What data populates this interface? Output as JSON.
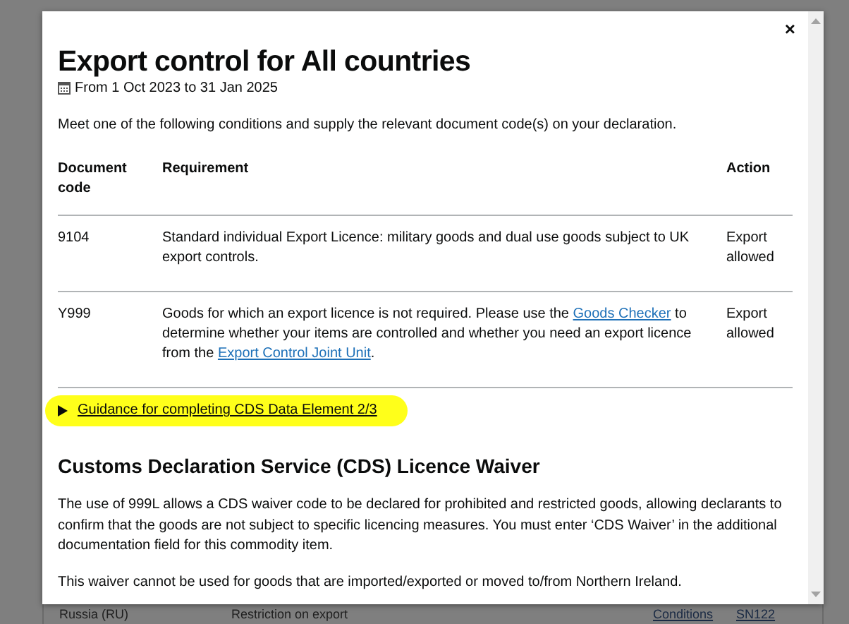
{
  "background_row": {
    "country": "Russia (RU)",
    "measure": "Restriction on export",
    "conditions_link": "Conditions",
    "footnote_link": "SN122"
  },
  "modal": {
    "close": "×",
    "title": "Export control for All countries",
    "date_range": "From 1 Oct 2023 to 31 Jan 2025",
    "intro": "Meet one of the following conditions and supply the relevant document code(s) on your declaration.",
    "table": {
      "columns": [
        "Document code",
        "Requirement",
        "Action"
      ],
      "rows": [
        {
          "code": "9104",
          "requirement": [
            {
              "text": "Standard individual Export Licence: military goods and dual use goods subject to UK export controls.",
              "link": false
            }
          ],
          "action": "Export allowed"
        },
        {
          "code": "Y999",
          "requirement": [
            {
              "text": "Goods for which an export licence is not required. Please use the ",
              "link": false
            },
            {
              "text": "Goods Checker",
              "link": true
            },
            {
              "text": " to determine whether your items are controlled and whether you need an export licence from the ",
              "link": false
            },
            {
              "text": "Export Control Joint Unit",
              "link": true
            },
            {
              "text": ".",
              "link": false
            }
          ],
          "action": "Export allowed"
        }
      ]
    },
    "guidance": {
      "label": "Guidance for completing CDS Data Element 2/3",
      "expanded": false,
      "highlighted": true
    },
    "waiver_heading": "Customs Declaration Service (CDS) Licence Waiver",
    "paragraphs": [
      "The use of 999L allows a CDS waiver code to be declared for prohibited and restricted goods, allowing declarants to confirm that the goods are not subject to specific licencing measures. You must enter ‘CDS Waiver’ in the additional documentation field for this commodity item.",
      "This waiver cannot be used for goods that are imported/exported or moved to/from Northern Ireland."
    ]
  }
}
